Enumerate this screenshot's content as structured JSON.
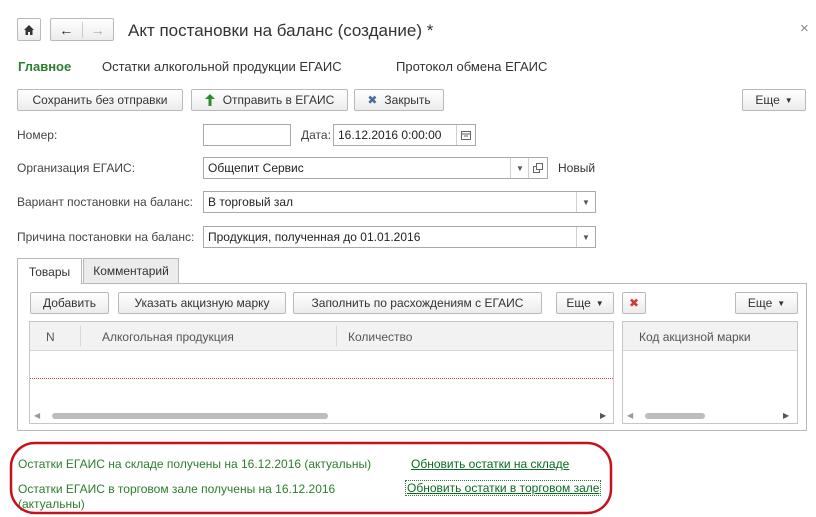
{
  "window": {
    "title": "Акт постановки на баланс (создание) *",
    "close_glyph": "×"
  },
  "nav_tabs": [
    {
      "label": "Главное"
    },
    {
      "label": "Остатки алкогольной продукции ЕГАИС"
    },
    {
      "label": "Протокол обмена ЕГАИС"
    }
  ],
  "toolbar": {
    "save_no_send": "Сохранить без отправки",
    "send_egais": "Отправить в ЕГАИС",
    "close": "Закрыть",
    "more": "Еще"
  },
  "form": {
    "number_label": "Номер:",
    "number_value": "",
    "date_label": "Дата:",
    "date_value": "16.12.2016  0:00:00",
    "org_label": "Организация ЕГАИС:",
    "org_value": "Общепит Сервис",
    "org_status": "Новый",
    "variant_label": "Вариант постановки на баланс:",
    "variant_value": "В торговый зал",
    "reason_label": "Причина постановки на баланс:",
    "reason_value": "Продукция, полученная до 01.01.2016"
  },
  "inner_tabs": [
    {
      "label": "Товары"
    },
    {
      "label": "Комментарий"
    }
  ],
  "table_toolbar": {
    "add": "Добавить",
    "excise": "Указать акцизную марку",
    "fill": "Заполнить по расхождениям с ЕГАИС",
    "more": "Еще",
    "more2": "Еще"
  },
  "table": {
    "columns": [
      "N",
      "Алкогольная продукция",
      "Количество"
    ],
    "side_column": "Код акцизной марки"
  },
  "status": {
    "warehouse_text": "Остатки ЕГАИС на складе получены на 16.12.2016 (актуальны)",
    "warehouse_link": "Обновить остатки на складе",
    "hall_text": "Остатки ЕГАИС в торговом зале получены на 16.12.2016 (актуальны)",
    "hall_link": "Обновить остатки в торговом зале"
  },
  "colors": {
    "accent_green": "#2e7d2e",
    "highlight_red": "#c0141c"
  }
}
